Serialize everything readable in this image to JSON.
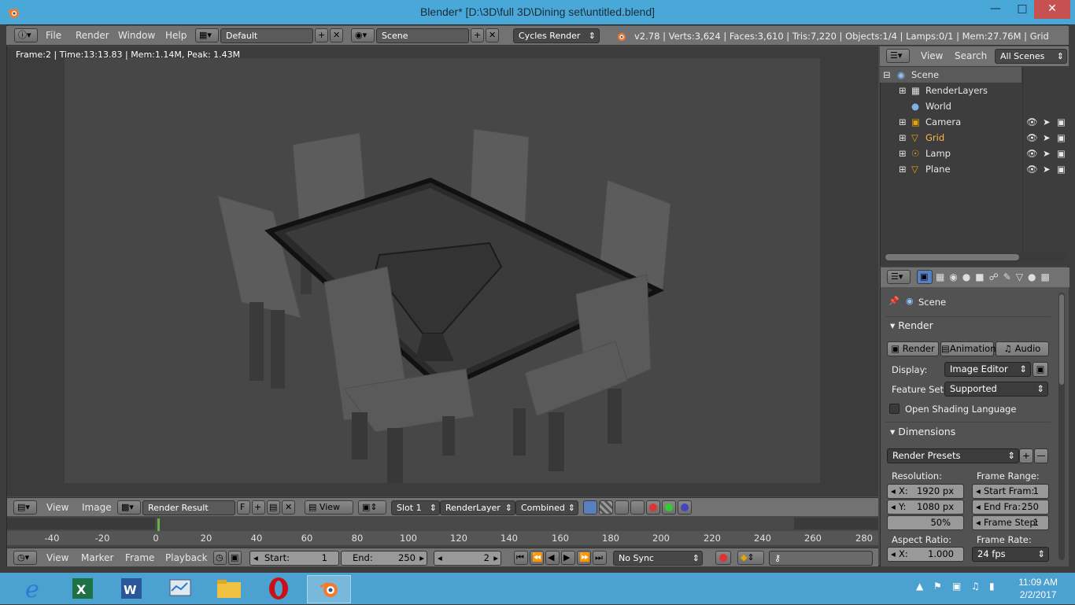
{
  "window": {
    "title": "Blender* [D:\\3D\\full 3D\\Dining set\\untitled.blend]"
  },
  "info_header": {
    "menus": [
      "File",
      "Render",
      "Window",
      "Help"
    ],
    "layout": "Default",
    "scene": "Scene",
    "engine": "Cycles Render",
    "stats": "v2.78 | Verts:3,624 | Faces:3,610 | Tris:7,220 | Objects:1/4 | Lamps:0/1 | Mem:27.76M | Grid"
  },
  "viewport": {
    "frame_info": "Frame:2 | Time:13:13.83 | Mem:1.14M, Peak: 1.43M"
  },
  "image_editor_header": {
    "menus": [
      "View",
      "Image"
    ],
    "image_name": "Render Result",
    "fake_user": "F",
    "view_label": "View",
    "slot": "Slot 1",
    "render_layer": "RenderLayer",
    "pass": "Combined"
  },
  "timeline": {
    "ticks": [
      "-40",
      "-20",
      "0",
      "20",
      "40",
      "60",
      "80",
      "100",
      "120",
      "140",
      "160",
      "180",
      "200",
      "220",
      "240",
      "260",
      "280"
    ],
    "current_frame": 2
  },
  "timeline_header": {
    "menus": [
      "View",
      "Marker",
      "Frame",
      "Playback"
    ],
    "start_label": "Start:",
    "start_value": "1",
    "end_label": "End:",
    "end_value": "250",
    "current_value": "2",
    "sync": "No Sync"
  },
  "outliner": {
    "header": {
      "view": "View",
      "search": "Search",
      "filter": "All Scenes"
    },
    "items": [
      {
        "label": "Scene",
        "icon": "scene-icon"
      },
      {
        "label": "RenderLayers",
        "icon": "renderlayers-icon"
      },
      {
        "label": "World",
        "icon": "world-icon"
      },
      {
        "label": "Camera",
        "icon": "camera-icon"
      },
      {
        "label": "Grid",
        "icon": "mesh-icon"
      },
      {
        "label": "Lamp",
        "icon": "lamp-icon"
      },
      {
        "label": "Plane",
        "icon": "mesh-icon"
      }
    ]
  },
  "properties": {
    "context": "Scene",
    "render_panel": {
      "title": "Render",
      "buttons": [
        "Render",
        "Animation",
        "Audio"
      ],
      "display_label": "Display:",
      "display_value": "Image Editor",
      "feature_label": "Feature Set:",
      "feature_value": "Supported",
      "osl_label": "Open Shading Language"
    },
    "dimensions_panel": {
      "title": "Dimensions",
      "presets": "Render Presets",
      "resolution_label": "Resolution:",
      "res_x": "X:",
      "res_x_value": "1920 px",
      "res_y": "Y:",
      "res_y_value": "1080 px",
      "res_pct": "50%",
      "frame_range_label": "Frame Range:",
      "start_frame": "Start Fram:",
      "start_frame_value": "1",
      "end_frame": "End Fra:",
      "end_frame_value": "250",
      "frame_step": "Frame Step:",
      "frame_step_value": "1",
      "aspect_label": "Aspect Ratio:",
      "aspect_x": "X:",
      "aspect_x_value": "1.000",
      "frame_rate_label": "Frame Rate:",
      "frame_rate_value": "24 fps"
    }
  },
  "taskbar": {
    "clock_time": "11:09 AM",
    "clock_date": "2/2/2017",
    "apps": [
      "internet-explorer-icon",
      "excel-icon",
      "word-icon",
      "resource-monitor-icon",
      "file-explorer-icon",
      "opera-icon",
      "blender-icon"
    ]
  }
}
